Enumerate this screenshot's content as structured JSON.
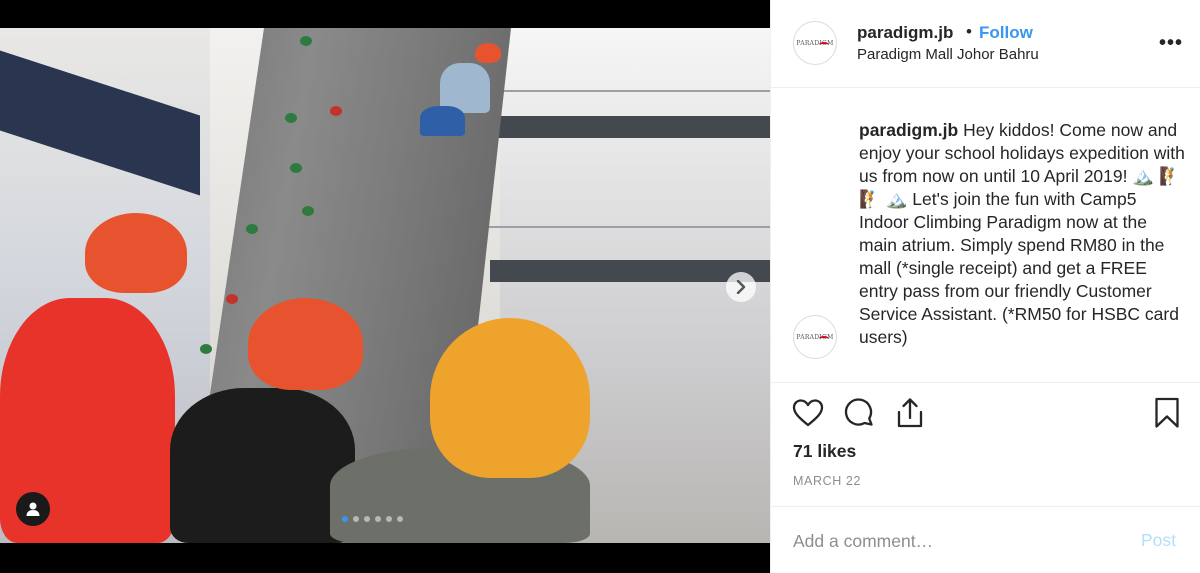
{
  "post": {
    "media": {
      "next_icon": "chevron-right-icon",
      "tag_icon": "user-icon",
      "slide_count": 6,
      "active_slide": 1
    },
    "header": {
      "username": "paradigm.jb",
      "separator": "•",
      "follow_label": "Follow",
      "location": "Paradigm Mall Johor Bahru",
      "more_label": "•••",
      "avatar_logo": "PARADIGM"
    },
    "caption": {
      "username": "paradigm.jb",
      "text": "Hey kiddos! Come now and enjoy your school holidays expedition with us from now on until 10 April 2019! 🏔️ 🧗 🧗 🏔️  Let's join the fun with Camp5 Indoor Climbing Paradigm now at the main atrium. Simply spend RM80 in the mall (*single receipt) and get a FREE entry pass from our friendly Customer Service Assistant. (*RM50 for HSBC card users)"
    },
    "actions": {
      "like_icon": "heart-icon",
      "comment_icon": "comment-icon",
      "share_icon": "share-icon",
      "save_icon": "bookmark-icon"
    },
    "likes": "71 likes",
    "date": "MARCH 22",
    "comment": {
      "placeholder": "Add a comment…",
      "value": "",
      "post_label": "Post"
    },
    "colors": {
      "accent": "#3897f0",
      "post_disabled": "#b2dffc",
      "text": "#262626",
      "muted": "#8e8e8e"
    }
  }
}
